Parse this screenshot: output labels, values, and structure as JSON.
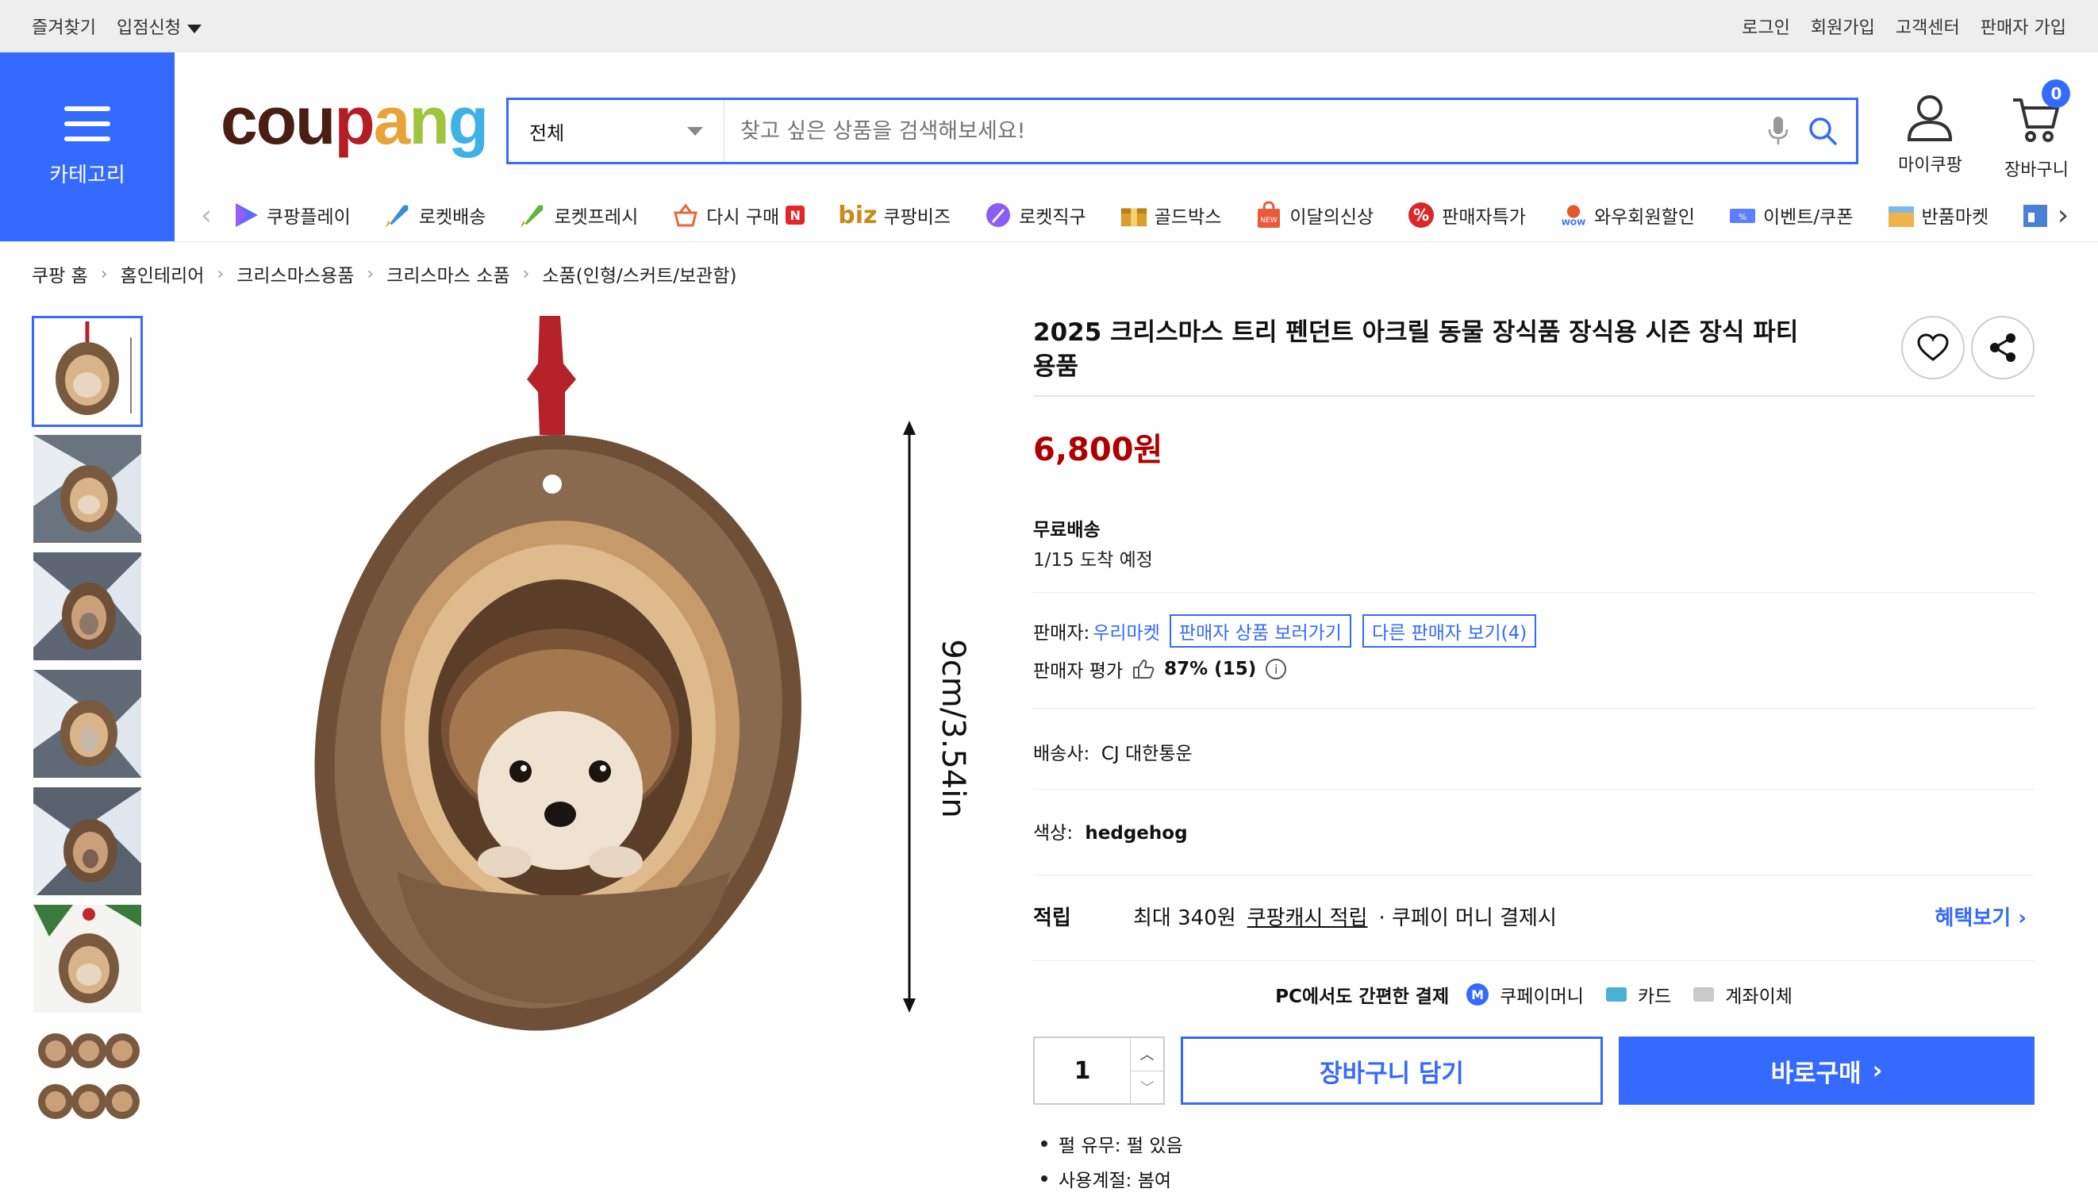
{
  "topbar": {
    "favorites": "즐겨찾기",
    "seller_apply": "입점신청",
    "login": "로그인",
    "signup": "회원가입",
    "customer_center": "고객센터",
    "seller_join": "판매자 가입"
  },
  "header": {
    "category_label": "카테고리",
    "logo": {
      "p1": "cou",
      "p2": "p",
      "p3": "a",
      "p4": "n",
      "p5": "g"
    },
    "search_scope": "전체",
    "search_placeholder": "찾고 싶은 상품을 검색해보세요!",
    "mypage": "마이쿠팡",
    "cart": "장바구니",
    "cart_count": "0"
  },
  "strip": [
    {
      "label": "쿠팡플레이",
      "icon": "play-icon"
    },
    {
      "label": "로켓배송",
      "icon": "rocket-icon"
    },
    {
      "label": "로켓프레시",
      "icon": "rocket-fresh-icon"
    },
    {
      "label": "다시 구매",
      "icon": "rebuy-basket-icon",
      "badge": "N"
    },
    {
      "label": "쿠팡비즈",
      "icon": "biz-logo",
      "prefix": "biz"
    },
    {
      "label": "로켓직구",
      "icon": "global-rocket-icon"
    },
    {
      "label": "골드박스",
      "icon": "goldbox-icon"
    },
    {
      "label": "이달의신상",
      "icon": "new-bag-icon"
    },
    {
      "label": "판매자특가",
      "icon": "percent-icon"
    },
    {
      "label": "와우회원할인",
      "icon": "wow-icon"
    },
    {
      "label": "이벤트/쿠폰",
      "icon": "coupon-icon"
    },
    {
      "label": "반품마켓",
      "icon": "return-market-icon"
    }
  ],
  "breadcrumb": [
    "쿠팡 홈",
    "홈인테리어",
    "크리스마스용품",
    "크리스마스 소품",
    "소품(인형/스커트/보관함)"
  ],
  "product": {
    "title": "2025 크리스마스 트리 펜던트 아크릴 동물 장식품 장식용 시즌 장식 파티 용품",
    "image_label": "9cm/3.54in",
    "price": "6,800원",
    "shipping_type": "무료배송",
    "arrival": "1/15 도착 예정",
    "seller_label": "판매자:",
    "seller_name": "우리마켓",
    "seller_products_btn": "판매자 상품 보러가기",
    "other_sellers_btn": "다른 판매자 보기(4)",
    "rating_label": "판매자 평가",
    "rating_value": "87% (15)",
    "carrier_label": "배송사:",
    "carrier": "CJ 대한통운",
    "color_label": "색상:",
    "color_value": "hedgehog",
    "reward_label": "적립",
    "reward_max": "최대 340원",
    "reward_link": "쿠팡캐시 적립",
    "reward_tail": "· 쿠페이 머니 결제시",
    "reward_more": "혜택보기",
    "pay_title": "PC에서도 간편한 결제",
    "pay_money": "쿠페이머니",
    "pay_card": "카드",
    "pay_bank": "계좌이체",
    "quantity": "1",
    "add_to_cart": "장바구니 담기",
    "buy_now": "바로구매",
    "details": [
      "펄 유무: 펄 있음",
      "사용계절: 봄여"
    ]
  },
  "colors": {
    "accent": "#346aff",
    "price": "#ae0000",
    "topbar_bg": "#eeeeee"
  }
}
